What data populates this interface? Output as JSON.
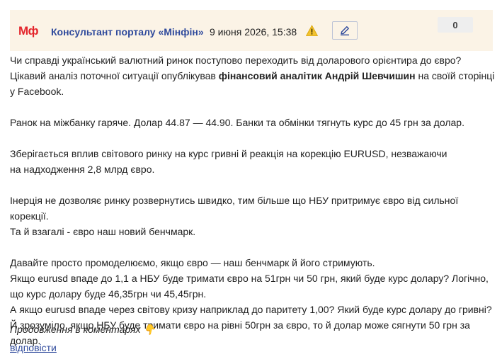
{
  "header": {
    "logo": "Мф",
    "author": "Консультант порталу «Мінфін»",
    "date": "9 июня 2026, 15:38",
    "count": "0",
    "colors": {
      "accent": "#2f4a9c",
      "logo": "#e3242b",
      "header_bg": "#fbf3e6"
    },
    "icons": {
      "warning": "warning-icon",
      "edit": "pencil-icon"
    }
  },
  "post": {
    "p1_l1": "Чи справді український валютний ринок поступово переходить від доларового орієнтира до євро?",
    "p1_l2_a": "Цікавий аналіз поточної ситуації опублікував ",
    "p1_l2_bold": "фінансовий аналітик Андрій Шевчишин",
    "p1_l2_b": " на своїй сторінці",
    "p1_l3": "у Facebook.",
    "p2": "Ранок на міжбанку гаряче. Долар 44.87 — 44.90. Банки та обмінки тягнуть курс до 45 грн за долар.",
    "p3_l1": "Зберігається вплив світового ринку на курс гривні й реакція на корекцію EURUSD, незважаючи",
    "p3_l2": "на надходження 2,8 млрд євро.",
    "p4_l1": "Інерція не дозволяє ринку розвернутись швидко, тим більше що НБУ притримує євро від сильної корекції.",
    "p4_l2": "Та й взагалі - євро наш новий бенчмарк.",
    "p5_l1": "Давайте просто промоделюємо, якщо євро — наш бенчмарк й його стримують.",
    "p5_l2": "Якщо eurusd впаде до 1,1 а НБУ буде тримати євро на 51грн чи 50 грн, який буде курс долару? Логічно,",
    "p5_l3": "що курс долару буде 46,35грн чи 45,45грн.",
    "p5_l4": "А якщо eurusd впаде через світову кризу наприклад до паритету 1,00? Який буде курс долару до гривні?",
    "p5_l5": "Й зрозуміло, якщо НБУ буде тримати євро на рівні 50грн за євро, то й долар може сягнути 50 грн за долар."
  },
  "footer": {
    "continued": "Продовження в коментарях 👇",
    "reply": "відповісти"
  }
}
